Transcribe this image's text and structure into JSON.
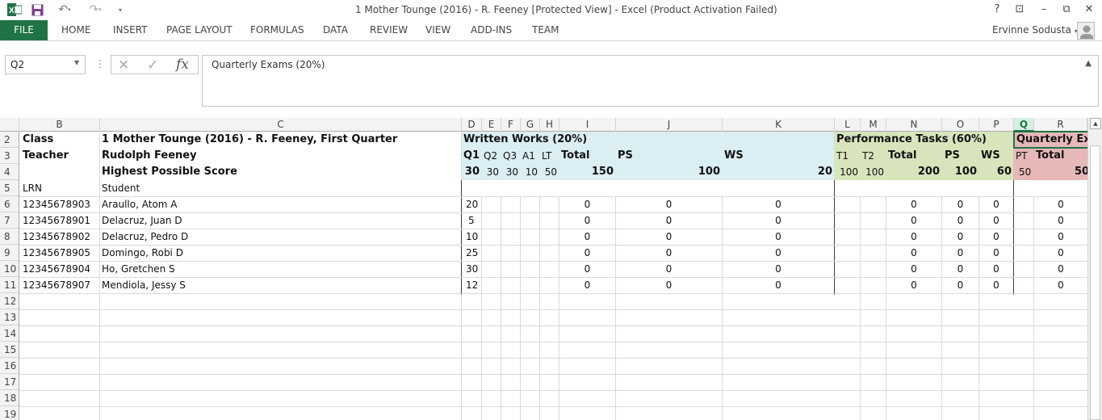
{
  "window": {
    "title": "1 Mother Tounge (2016) - R. Feeney  [Protected View] - Excel (Product Activation Failed)",
    "help": "?",
    "restore_ribbon": "⊡",
    "minimize": "–",
    "maximize": "⧉",
    "close": "✕"
  },
  "ribbon": {
    "file": "FILE",
    "tabs": [
      "HOME",
      "INSERT",
      "PAGE LAYOUT",
      "FORMULAS",
      "DATA",
      "REVIEW",
      "VIEW",
      "ADD-INS",
      "TEAM"
    ],
    "user": "Ervinne Sodusta"
  },
  "formula_bar": {
    "name_box": "Q2",
    "formula": "Quarterly Exams (20%)"
  },
  "colors": {
    "accent": "#217346",
    "written_works_fill": "#daeef3",
    "performance_fill": "#d8e4bc",
    "quarterly_fill": "#e6b8b7"
  },
  "sheet": {
    "columns": [
      "B",
      "C",
      "D",
      "E",
      "F",
      "G",
      "H",
      "I",
      "J",
      "K",
      "L",
      "M",
      "N",
      "O",
      "P",
      "Q",
      "R"
    ],
    "row_numbers": [
      "2",
      "3",
      "4",
      "5",
      "6",
      "7",
      "8",
      "9",
      "10",
      "11",
      "12",
      "13",
      "14",
      "15",
      "16",
      "17",
      "18",
      "19"
    ],
    "row2": {
      "b": "Class",
      "c": "1 Mother Tounge (2016) - R. Feeney, First Quarter",
      "ww": "Written Works (20%)",
      "pt": "Performance Tasks (60%)",
      "qe": "Quarterly Ex"
    },
    "row3": {
      "b": "Teacher",
      "c": "Rudolph Feeney",
      "d": "Q1",
      "e": "Q2",
      "f": "Q3",
      "g": "A1",
      "h": "LT",
      "i": "Total",
      "j": "PS",
      "k": "WS",
      "l": "T1",
      "m": "T2",
      "n": "Total",
      "o": "PS",
      "p": "WS",
      "q": "PT",
      "r": "Total"
    },
    "row4": {
      "c": "Highest Possible Score",
      "d": "30",
      "e": "30",
      "f": "30",
      "g": "10",
      "h": "50",
      "i": "150",
      "j": "100",
      "k": "20",
      "l": "100",
      "m": "100",
      "n": "200",
      "o": "100",
      "p": "60",
      "q": "50",
      "r": "50"
    },
    "row5": {
      "b": "LRN",
      "c": "Student"
    },
    "students": [
      {
        "lrn": "12345678903",
        "name": "Araullo, Atom A",
        "q1": "20",
        "i": "0",
        "j": "0",
        "k": "0",
        "n": "0",
        "o": "0",
        "p": "0",
        "r": "0"
      },
      {
        "lrn": "12345678901",
        "name": "Delacruz, Juan D",
        "q1": "5",
        "i": "0",
        "j": "0",
        "k": "0",
        "n": "0",
        "o": "0",
        "p": "0",
        "r": "0"
      },
      {
        "lrn": "12345678902",
        "name": "Delacruz, Pedro D",
        "q1": "10",
        "i": "0",
        "j": "0",
        "k": "0",
        "n": "0",
        "o": "0",
        "p": "0",
        "r": "0"
      },
      {
        "lrn": "12345678905",
        "name": "Domingo, Robi D",
        "q1": "25",
        "i": "0",
        "j": "0",
        "k": "0",
        "n": "0",
        "o": "0",
        "p": "0",
        "r": "0"
      },
      {
        "lrn": "12345678904",
        "name": "Ho, Gretchen S",
        "q1": "30",
        "i": "0",
        "j": "0",
        "k": "0",
        "n": "0",
        "o": "0",
        "p": "0",
        "r": "0"
      },
      {
        "lrn": "12345678907",
        "name": "Mendiola, Jessy S",
        "q1": "12",
        "i": "0",
        "j": "0",
        "k": "0",
        "n": "0",
        "o": "0",
        "p": "0",
        "r": "0"
      }
    ]
  }
}
